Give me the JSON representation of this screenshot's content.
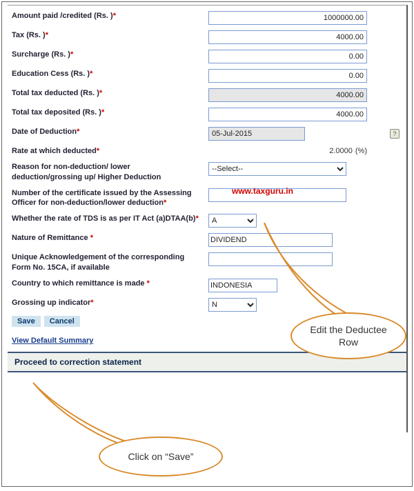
{
  "watermark": "www.taxguru.in",
  "fields": {
    "amount_paid": {
      "label": "Amount paid /credited (Rs. )",
      "value": "1000000.00"
    },
    "tax": {
      "label": "Tax (Rs. )",
      "value": "4000.00"
    },
    "surcharge": {
      "label": "Surcharge (Rs. )",
      "value": "0.00"
    },
    "edu_cess": {
      "label": "Education Cess (Rs. )",
      "value": "0.00"
    },
    "total_deducted": {
      "label": "Total tax deducted (Rs. )",
      "value": "4000.00"
    },
    "total_deposited": {
      "label": "Total tax deposited (Rs. )",
      "value": "4000.00"
    },
    "date_deduction": {
      "label": "Date of Deduction",
      "value": "05-Jul-2015"
    },
    "rate": {
      "label": "Rate at which deducted",
      "value": "2.0000",
      "unit": "(%)"
    },
    "reason": {
      "label": "Reason for non-deduction/ lower deduction/grossing up/ Higher Deduction",
      "value": "--Select--"
    },
    "cert_number": {
      "label": "Number of the certificate issued by the Assessing Officer for non-deduction/lower deduction",
      "value": ""
    },
    "tds_per_act": {
      "label": "Whether the rate of TDS is as per IT Act (a)DTAA(b)",
      "value": "A"
    },
    "nature": {
      "label": "Nature of Remittance ",
      "value": "DIVIDEND"
    },
    "unique_ack": {
      "label": "Unique Acknowledgement of the corresponding Form No. 15CA, if available",
      "value": ""
    },
    "country": {
      "label": "Country to which remittance is made ",
      "value": "INDONESIA"
    },
    "grossing": {
      "label": "Grossing up indicator",
      "value": "N"
    }
  },
  "buttons": {
    "save": "Save",
    "cancel": "Cancel"
  },
  "link_summary": "View Default Summary",
  "proceed_text": "Proceed to correction statement",
  "callouts": {
    "edit": "Edit the Deductee Row",
    "save": "Click on “Save”"
  },
  "help_icon": "?"
}
